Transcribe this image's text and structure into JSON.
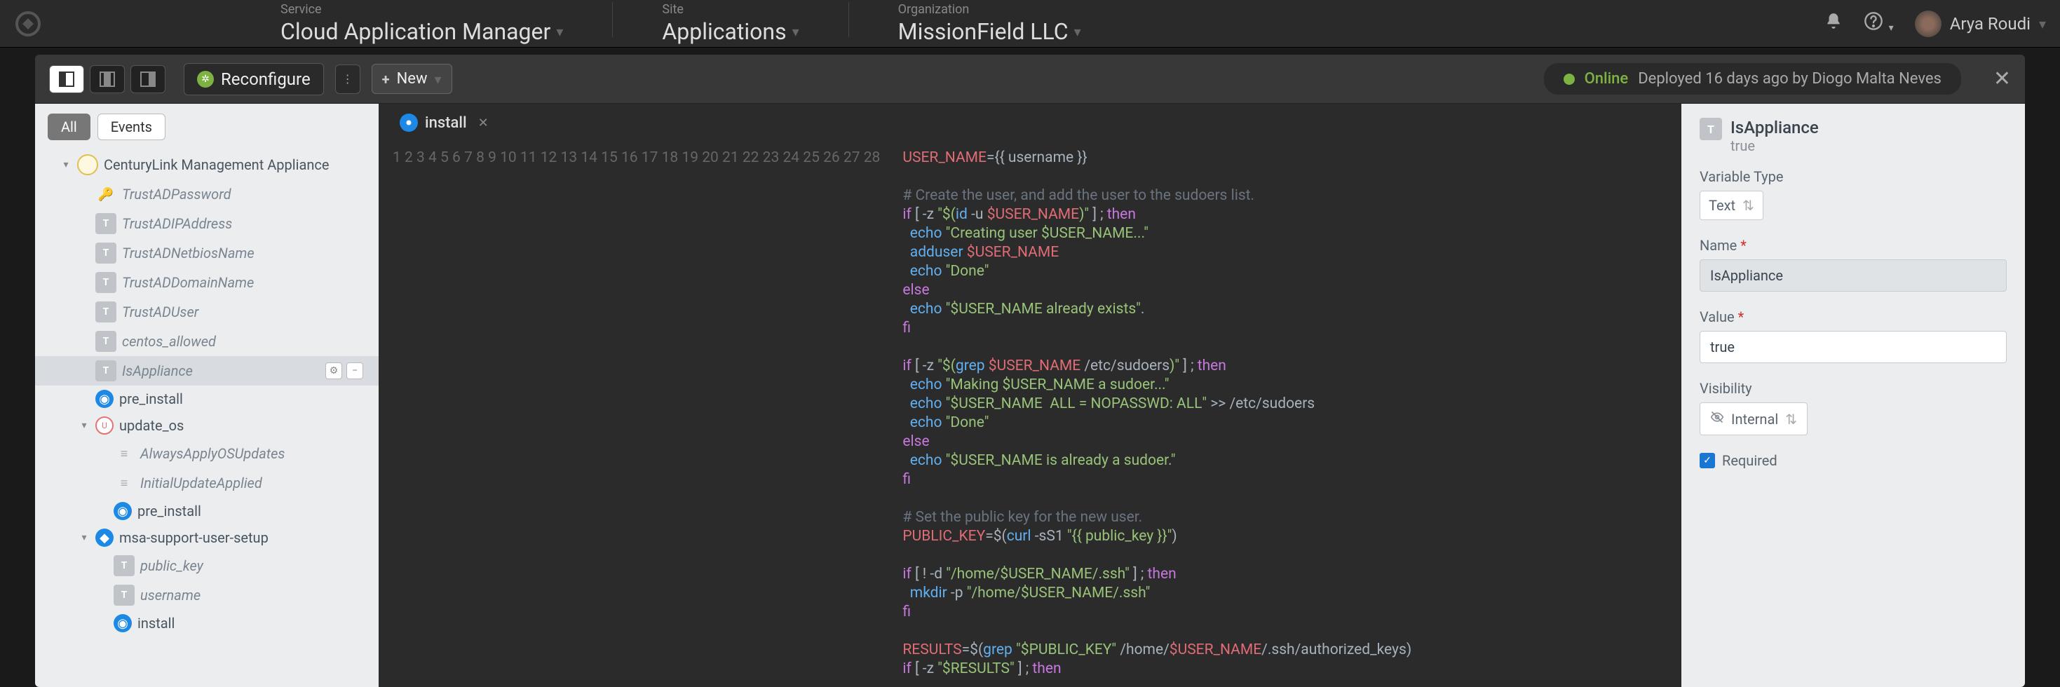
{
  "topbar": {
    "service_label": "Service",
    "service_value": "Cloud Application Manager",
    "site_label": "Site",
    "site_value": "Applications",
    "org_label": "Organization",
    "org_value": "MissionField LLC",
    "user": "Arya Roudi"
  },
  "toolbar": {
    "reconfigure": "Reconfigure",
    "new": "New",
    "status": "Online",
    "deploy_info": "Deployed 16 days ago by Diogo Malta Neves"
  },
  "filter": {
    "all": "All",
    "events": "Events"
  },
  "tree": {
    "root": "CenturyLink Management Appliance",
    "vars": [
      "TrustADPassword",
      "TrustADIPAddress",
      "TrustADNetbiosName",
      "TrustADDomainName",
      "TrustADUser",
      "centos_allowed",
      "IsAppliance"
    ],
    "scripts1": [
      "pre_install"
    ],
    "update_os": "update_os",
    "update_vars": [
      "AlwaysApplyOSUpdates",
      "InitialUpdateApplied"
    ],
    "scripts2": [
      "pre_install"
    ],
    "msa": "msa-support-user-setup",
    "msa_vars": [
      "public_key",
      "username"
    ],
    "scripts3": [
      "install"
    ]
  },
  "tab": {
    "name": "install"
  },
  "code_lines": [
    {
      "n": 1,
      "h": "<span class='var'>USER_NAME</span>={{ username }}"
    },
    {
      "n": 2,
      "h": ""
    },
    {
      "n": 3,
      "h": "<span class='cmt'># Create the user, and add the user to the sudoers list.</span>"
    },
    {
      "n": 4,
      "h": "<span class='kw'>if</span> [ -z <span class='str'>\"$(</span><span class='fn'>id</span> -u <span class='var'>$USER_NAME</span><span class='str'>)\"</span> ] ; <span class='kw'>then</span>"
    },
    {
      "n": 5,
      "h": "  <span class='fn'>echo</span> <span class='str'>\"Creating user $USER_NAME...\"</span>"
    },
    {
      "n": 6,
      "h": "  <span class='fn'>adduser</span> <span class='var'>$USER_NAME</span>"
    },
    {
      "n": 7,
      "h": "  <span class='fn'>echo</span> <span class='str'>\"Done\"</span>"
    },
    {
      "n": 8,
      "h": "<span class='kw'>else</span>"
    },
    {
      "n": 9,
      "h": "  <span class='fn'>echo</span> <span class='str'>\"$USER_NAME already exists\"</span>."
    },
    {
      "n": 10,
      "h": "<span class='kw'>fi</span>"
    },
    {
      "n": 11,
      "h": ""
    },
    {
      "n": 12,
      "h": "<span class='kw'>if</span> [ -z <span class='str'>\"$(</span><span class='fn'>grep</span> <span class='var'>$USER_NAME</span> /etc/sudoers<span class='str'>)\"</span> ] ; <span class='kw'>then</span>"
    },
    {
      "n": 13,
      "h": "  <span class='fn'>echo</span> <span class='str'>\"Making $USER_NAME a sudoer...\"</span>"
    },
    {
      "n": 14,
      "h": "  <span class='fn'>echo</span> <span class='str'>\"$USER_NAME  ALL = NOPASSWD: ALL\"</span> &gt;&gt; /etc/sudoers"
    },
    {
      "n": 15,
      "h": "  <span class='fn'>echo</span> <span class='str'>\"Done\"</span>"
    },
    {
      "n": 16,
      "h": "<span class='kw'>else</span>"
    },
    {
      "n": 17,
      "h": "  <span class='fn'>echo</span> <span class='str'>\"$USER_NAME is already a sudoer.\"</span>"
    },
    {
      "n": 18,
      "h": "<span class='kw'>fi</span>"
    },
    {
      "n": 19,
      "h": ""
    },
    {
      "n": 20,
      "h": "<span class='cmt'># Set the public key for the new user.</span>"
    },
    {
      "n": 21,
      "h": "<span class='var'>PUBLIC_KEY</span>=$(<span class='fn'>curl</span> -sS1 <span class='str'>\"{{ public_key }}\"</span>)"
    },
    {
      "n": 22,
      "h": ""
    },
    {
      "n": 23,
      "h": "<span class='kw'>if</span> [ ! -d <span class='str'>\"/home/$USER_NAME/.ssh\"</span> ] ; <span class='kw'>then</span>"
    },
    {
      "n": 24,
      "h": "  <span class='fn'>mkdir</span> -p <span class='str'>\"/home/$USER_NAME/.ssh\"</span>"
    },
    {
      "n": 25,
      "h": "<span class='kw'>fi</span>"
    },
    {
      "n": 26,
      "h": ""
    },
    {
      "n": 27,
      "h": "<span class='var'>RESULTS</span>=$(<span class='fn'>grep</span> <span class='str'>\"$PUBLIC_KEY\"</span> /home/<span class='var'>$USER_NAME</span>/.ssh/authorized_keys)"
    },
    {
      "n": 28,
      "h": "<span class='kw'>if</span> [ -z <span class='str'>\"$RESULTS\"</span> ] ; <span class='kw'>then</span>"
    }
  ],
  "prop": {
    "title": "IsAppliance",
    "sub": "true",
    "vartype_label": "Variable Type",
    "vartype_value": "Text",
    "name_label": "Name",
    "name_value": "IsAppliance",
    "value_label": "Value",
    "value_value": "true",
    "vis_label": "Visibility",
    "vis_value": "Internal",
    "required_label": "Required"
  }
}
